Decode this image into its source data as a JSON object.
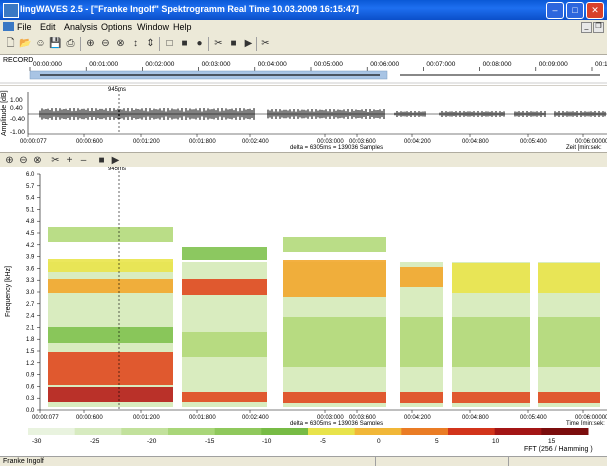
{
  "window": {
    "title": "lingWAVES 2.5 - [\"Franke Ingolf\" Spektrogramm Real Time  10.03.2009 16:15:47]",
    "minimize_icon": "minimize-icon",
    "maximize_icon": "maximize-icon",
    "close_icon": "close-icon"
  },
  "menu": [
    "File",
    "Edit",
    "Analysis",
    "Options",
    "Window",
    "Help"
  ],
  "toolbar_icons": [
    "new-icon",
    "open-icon",
    "record-icon",
    "save-icon",
    "print-icon",
    "zoom-in-icon",
    "zoom-out-icon",
    "zoom-fit-icon",
    "zoom-vertical-icon",
    "fit-vertical-icon",
    "select-icon",
    "square-icon",
    "circle-icon",
    "marker-icon",
    "stop-icon",
    "play-icon",
    "export-icon"
  ],
  "record": {
    "label": "RECORD",
    "ticks": [
      "00:00:000",
      "00:01:000",
      "00:02:000",
      "00:03:000",
      "00:04:000",
      "00:05:000",
      "00:06:000",
      "00:07:000",
      "00:08:000",
      "00:09:000",
      "00:10:0"
    ]
  },
  "waveform": {
    "ylabel": "Amplitude [dB]",
    "yticks": [
      "1.00",
      "0.40",
      "-0.40",
      "-1.00"
    ],
    "cursor_label": "945ms",
    "xticks": [
      "00:00:077",
      "00:00:600",
      "00:01:200",
      "00:01:800",
      "00:02:400",
      "00:03:000",
      "00:03:600",
      "00:04:200",
      "00:04:800",
      "00:05:400",
      "00:06:000000:06:3"
    ],
    "delta": "delta = 6305ms = 139036 Samples",
    "xunit": "Zeit [min:sek:"
  },
  "spectrogram": {
    "cursor_label": "945ms",
    "ylabel": "Frequency [kHz]",
    "yticks": [
      "6.0",
      "5.7",
      "5.4",
      "5.1",
      "4.8",
      "4.5",
      "4.2",
      "3.9",
      "3.6",
      "3.3",
      "3.0",
      "2.7",
      "2.4",
      "2.1",
      "1.8",
      "1.5",
      "1.2",
      "0.9",
      "0.6",
      "0.3",
      "0.0"
    ],
    "xticks": [
      "00:00:077",
      "00:00:600",
      "00:01:200",
      "00:01:800",
      "00:02:400",
      "00:03:000",
      "00:03:600",
      "00:04:200",
      "00:04:800",
      "00:05:400",
      "00:06:000000:06:3"
    ],
    "delta": "delta = 6305ms = 139036 Samples",
    "xunit": "Time [min:sek:"
  },
  "colorbar": {
    "ticks": [
      "-30",
      "-25",
      "-20",
      "-15",
      "-10",
      "-5",
      "0",
      "5",
      "10",
      "15"
    ],
    "fft": "FFT (256 / Hamming )"
  },
  "status": {
    "name": "Franke Ingolf"
  }
}
